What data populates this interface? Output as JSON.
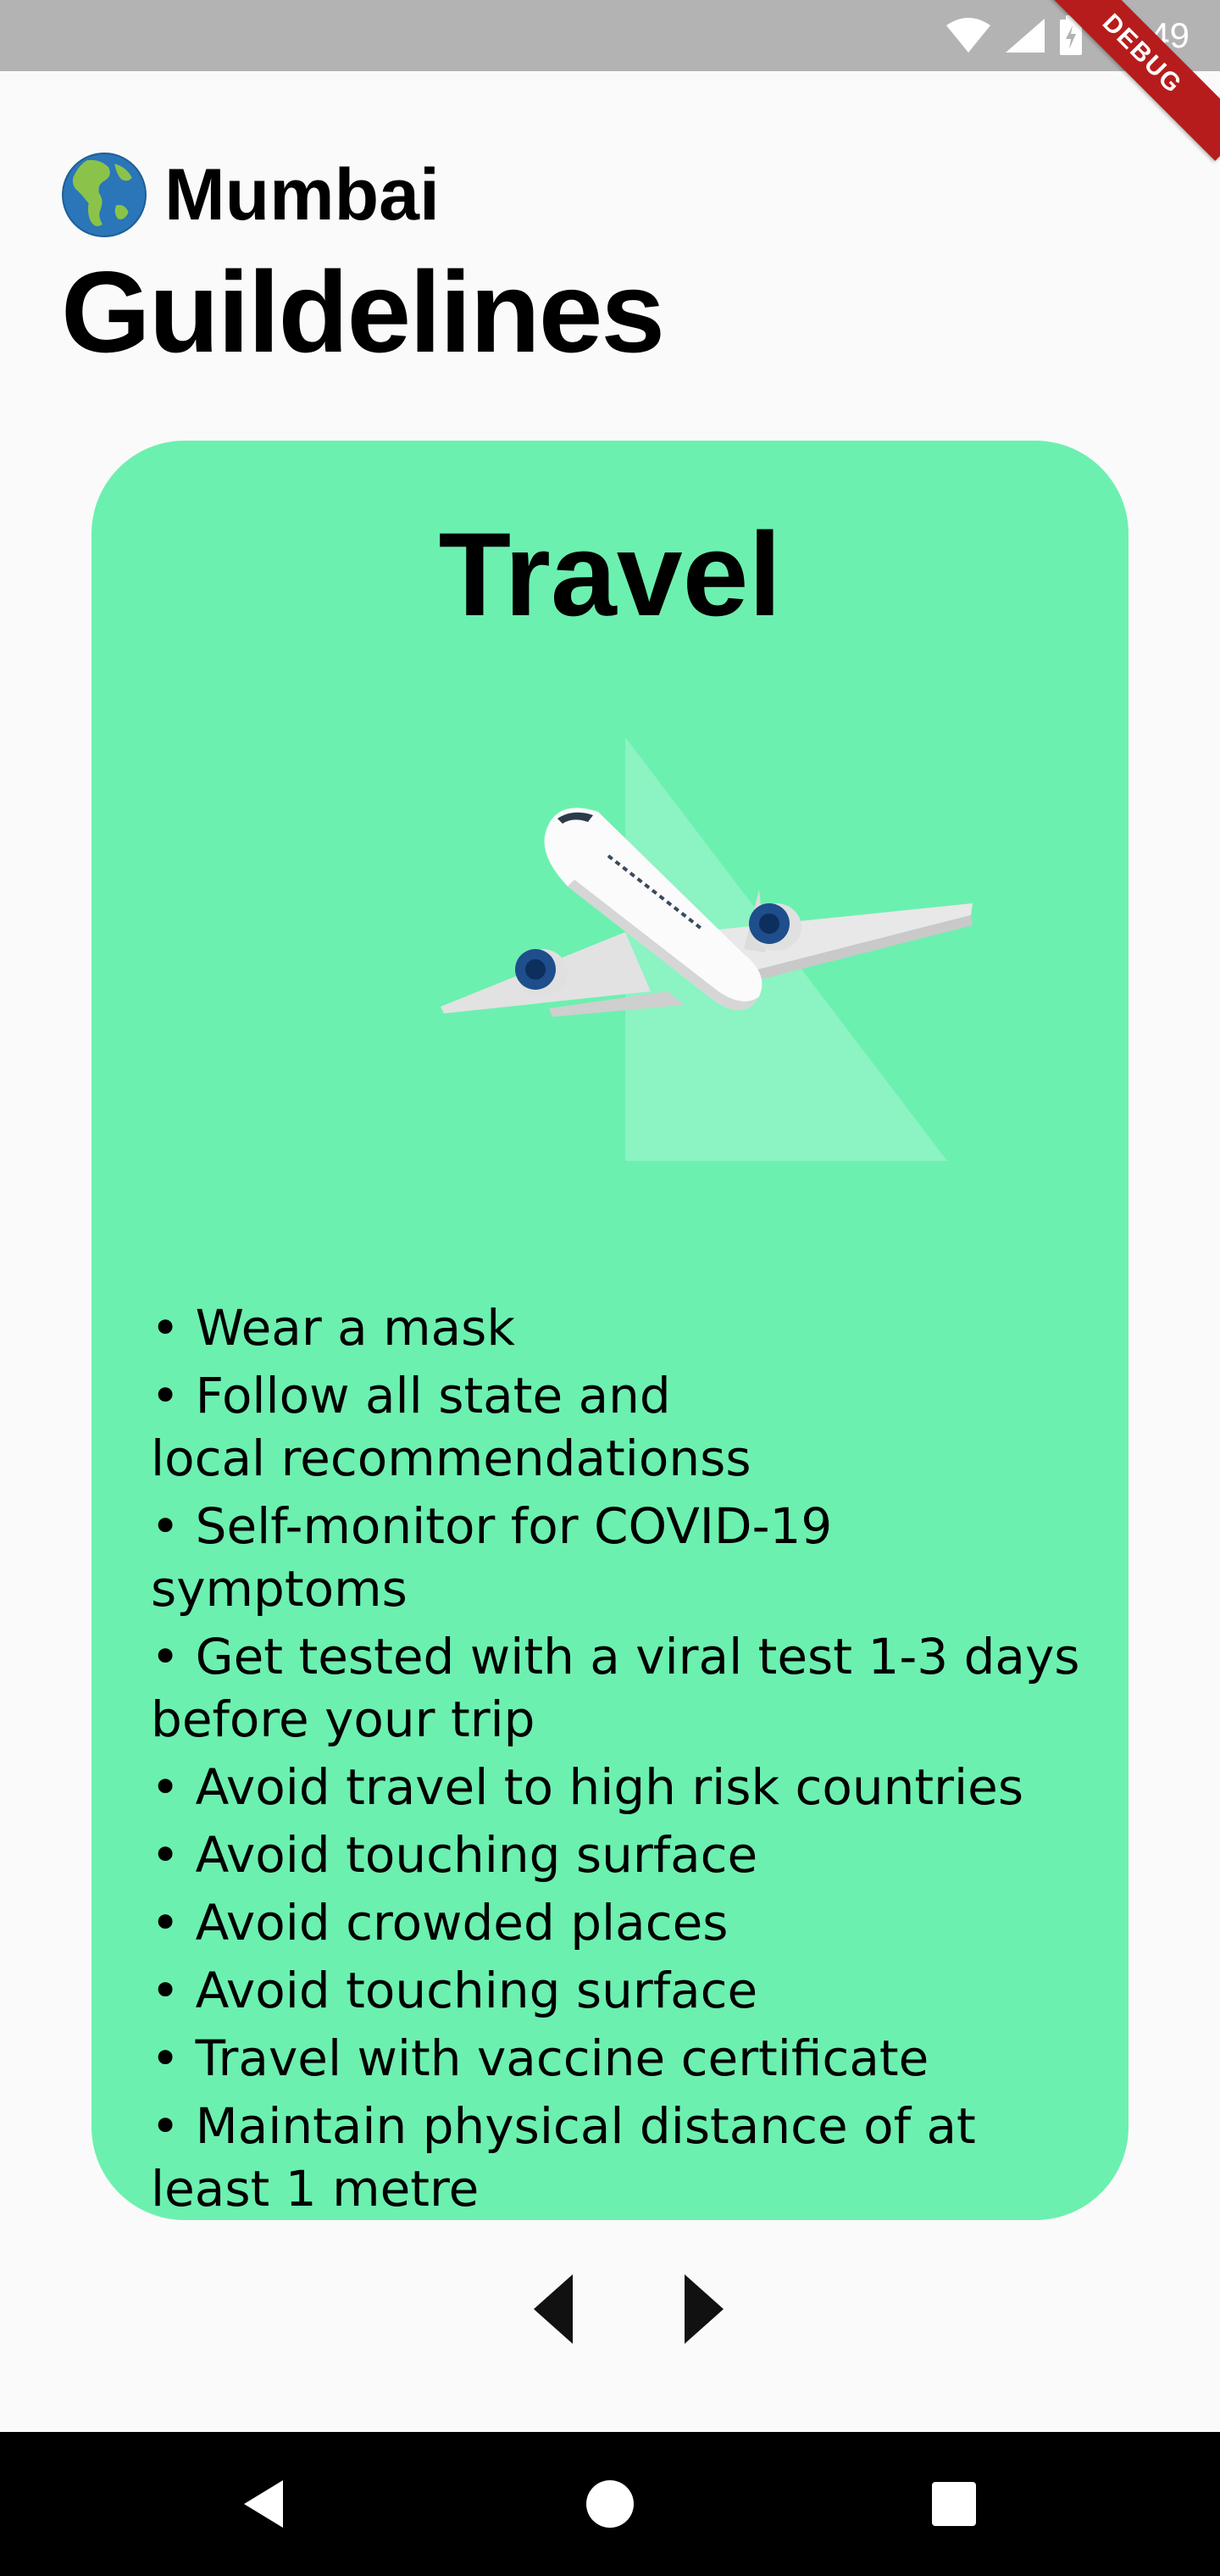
{
  "status_bar": {
    "time": "12:49",
    "debug_label": "DEBUG"
  },
  "header": {
    "city": "Mumbai",
    "title": "Guildelines",
    "globe_icon": "globe-americas-icon"
  },
  "card": {
    "title": "Travel",
    "background": "#6cf0af",
    "illustration_icon": "airplane-icon",
    "guidelines": [
      "• Wear a mask",
      "• Follow all state and\nlocal recommendationss",
      "• Self-monitor for COVID-19 symptoms",
      "• Get tested with a viral test 1-3 days before your trip",
      "• Avoid travel to high risk countries",
      "• Avoid touching surface",
      "• Avoid crowded places",
      "• Avoid touching surface",
      "• Travel with vaccine certificate",
      "• Maintain physical distance of at least 1 metre"
    ]
  },
  "pager": {
    "prev_icon": "arrow-left-icon",
    "next_icon": "arrow-right-icon"
  },
  "system_nav": {
    "back_icon": "back-triangle-icon",
    "home_icon": "home-circle-icon",
    "recents_icon": "recents-square-icon"
  }
}
